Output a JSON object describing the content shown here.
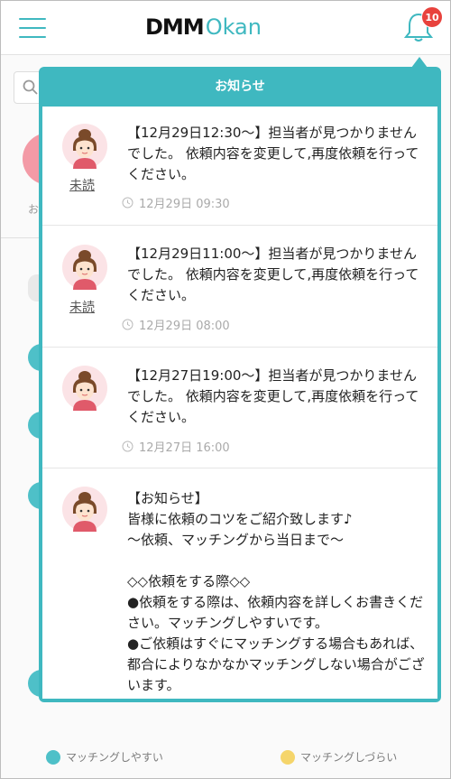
{
  "header": {
    "logo_dmm": "DMM",
    "logo_okan": "Okan",
    "badge_count": "10"
  },
  "background": {
    "partial_text": "お",
    "legend": [
      {
        "label": "マッチングしやすい",
        "color": "#4ec0c8"
      },
      {
        "label": "マッチングしづらい",
        "color": "#f5d56b"
      }
    ]
  },
  "popup": {
    "title": "お知らせ",
    "notices": [
      {
        "message": "【12月29日12:30〜】担当者が見つかりませんでした。 依頼内容を変更して,再度依頼を行ってください。",
        "time": "12月29日 09:30",
        "unread_label": "未読"
      },
      {
        "message": "【12月29日11:00〜】担当者が見つかりませんでした。 依頼内容を変更して,再度依頼を行ってください。",
        "time": "12月29日 08:00",
        "unread_label": "未読"
      },
      {
        "message": "【12月27日19:00〜】担当者が見つかりませんでした。 依頼内容を変更して,再度依頼を行ってください。",
        "time": "12月27日 16:00"
      }
    ],
    "announcement": {
      "message": "【お知らせ】\n皆様に依頼のコツをご紹介致します♪\n〜依頼、マッチングから当日まで〜\n\n◇◇依頼をする際◇◇\n●依頼をする際は、依頼内容を詳しくお書きください。マッチングしやすいです。\n●ご依頼はすぐにマッチングする場合もあれば、都合によりなかなかマッチングしない場合がございます。\n●マッチングしたら通知がきますが、通知"
    }
  },
  "colors": {
    "accent": "#3fb8c0",
    "badge": "#e8423d"
  }
}
